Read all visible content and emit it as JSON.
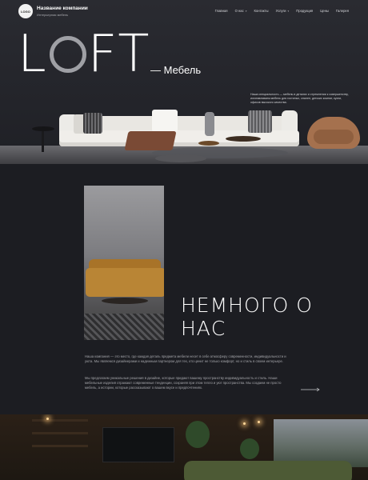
{
  "header": {
    "logo_text": "LOGO",
    "company_name": "Название компании",
    "company_sub": "Интерьерная мебель"
  },
  "nav": [
    {
      "label": "Главная",
      "has_dropdown": false
    },
    {
      "label": "О нас",
      "has_dropdown": true
    },
    {
      "label": "Контакты",
      "has_dropdown": false
    },
    {
      "label": "Услуги",
      "has_dropdown": true
    },
    {
      "label": "Продукция",
      "has_dropdown": false
    },
    {
      "label": "Цены",
      "has_dropdown": false
    },
    {
      "label": "Галерея",
      "has_dropdown": false
    }
  ],
  "hero": {
    "title_l": "L",
    "title_rest": "FT",
    "subtitle": "— Мебель",
    "description": "Наша специальность — мебель в деталях и стремлении к совершенству, изготавливаем мебель для гостиных, спален, детских комнат, кухни, офисов высокого качества."
  },
  "about": {
    "title": "НЕМНОГО О НАС",
    "p1": "Наша компания — это место, где каждая деталь предмета мебели несет в себе атмосферу современности, индивидуальности и уюта. Мы являемся дизайнерами и надежным партнером для тех, кто ценит не только комфорт, но и стиль в своем интерьере.",
    "p2": "Мы предлагаем уникальные решения в дизайне, которые придают вашему пространству индивидуальность и стиль. Наши мебельные изделия отражают современные тенденции, сохраняя при этом тепло и уют пространства. Мы создаем не просто мебель, а истории, которые рассказывают о вашем вкусе и предпочтениях."
  },
  "icons": {
    "chevron": "chevron-down-icon",
    "arrow": "arrow-right-icon"
  },
  "colors": {
    "background": "#1c1d22",
    "accent_text": "#ffffff",
    "muted_text": "#a4a5aa"
  }
}
